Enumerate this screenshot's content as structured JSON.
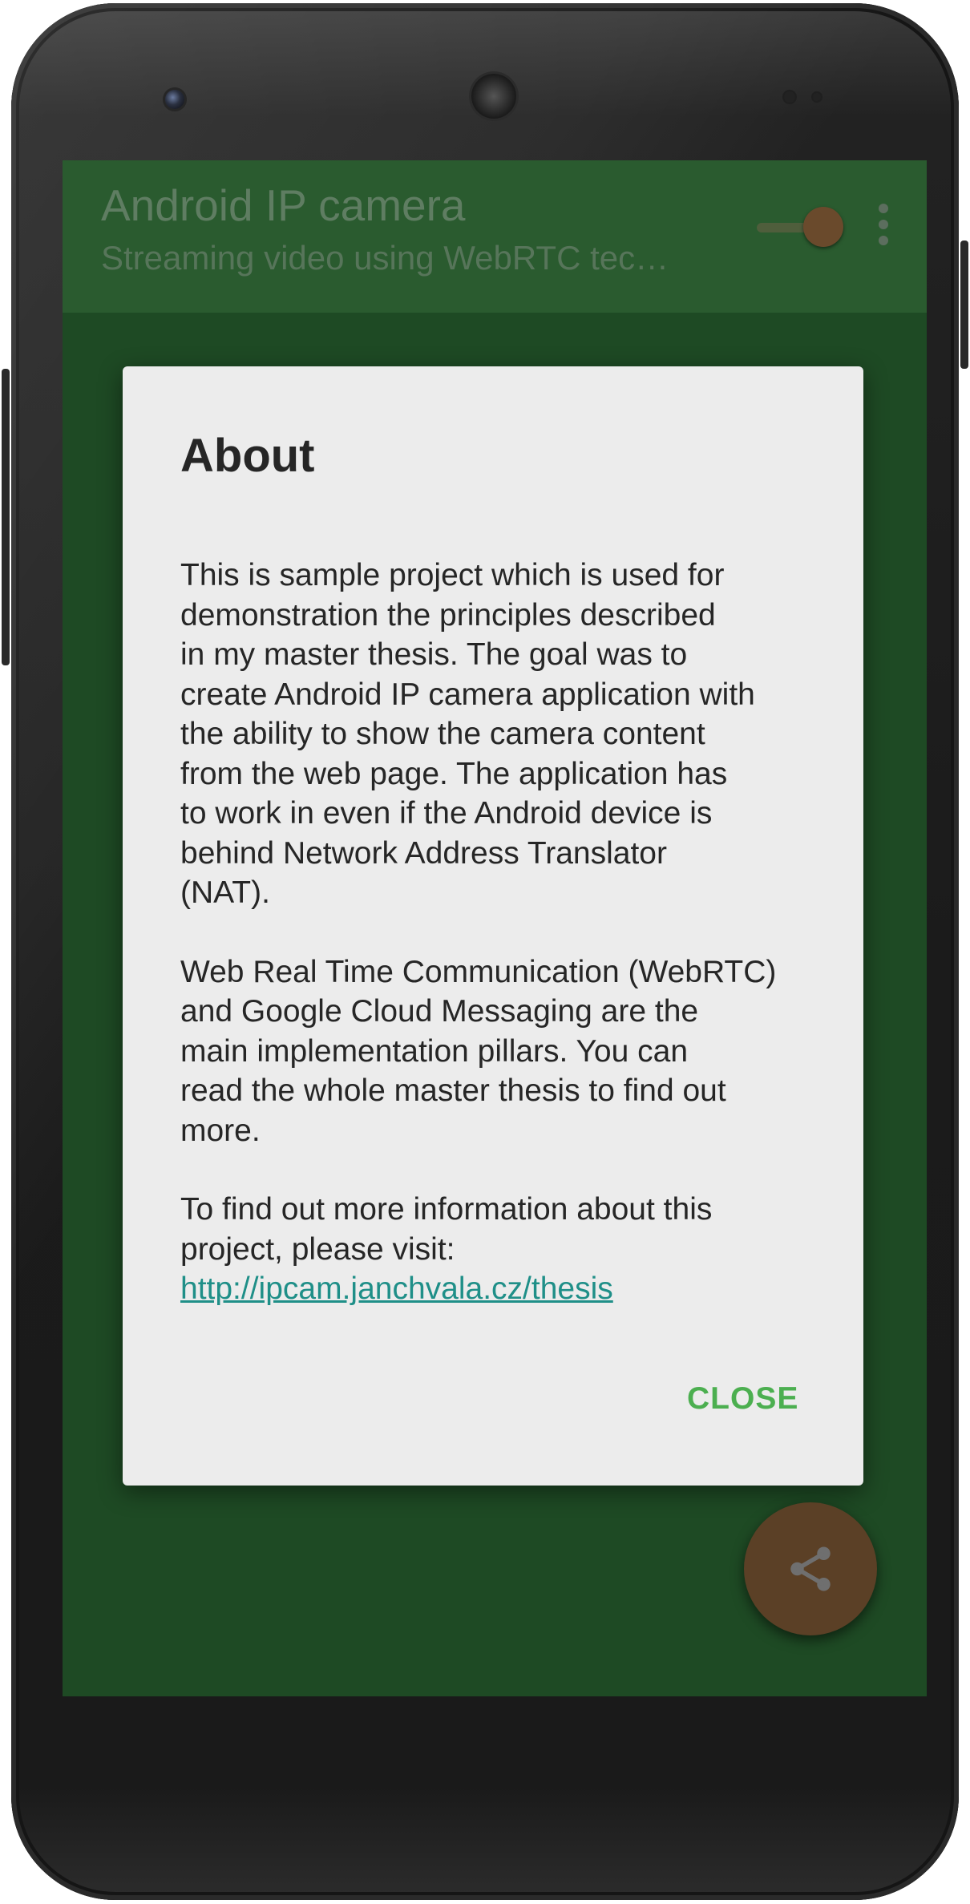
{
  "app": {
    "title": "Android IP camera",
    "subtitle": "Streaming video using WebRTC tec…"
  },
  "toggle": {
    "state": "on"
  },
  "icons": {
    "overflow": "more-vert-icon",
    "fab": "share-icon"
  },
  "dialog": {
    "title": "About",
    "paragraph1": "This is sample project which is used for\ndemonstration the principles described\nin my master thesis. The goal was to\ncreate Android IP camera application with\nthe ability to show the camera content\nfrom the web page. The application has\nto work in even if the Android device is\nbehind Network Address Translator\n(NAT).",
    "paragraph2": "Web Real Time Communication (WebRTC)\nand Google Cloud Messaging are the\nmain implementation pillars. You can\nread the whole master thesis to find out\nmore.",
    "paragraph3": "To find out more information about this\nproject, please visit:",
    "link": "http://ipcam.janchvala.cz/thesis",
    "close_label": "CLOSE"
  },
  "colors": {
    "screen_dimmed": "#1e4a24",
    "dialog_background": "#ececec",
    "link": "#1f8f88",
    "close_button": "#4caf50",
    "fab": "#5b4026"
  }
}
